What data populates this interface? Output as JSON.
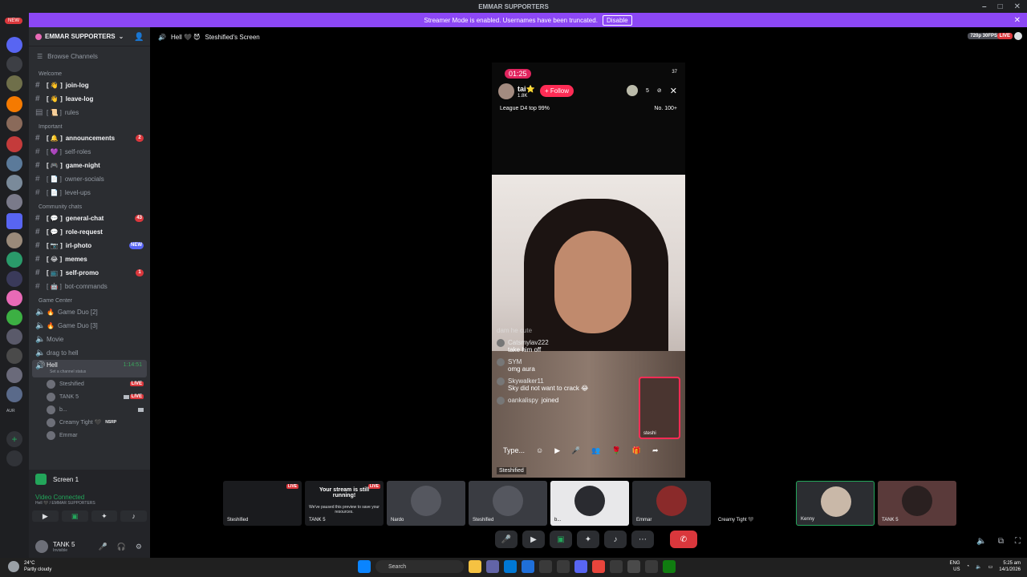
{
  "titlebar": {
    "title": "EMMAR SUPPORTERS",
    "min": "–",
    "max": "□",
    "close": "✕"
  },
  "banner": {
    "message": "Streamer Mode is enabled. Usernames have been truncated.",
    "button": "Disable",
    "close": "✕"
  },
  "rail": {
    "new_label": "NEW",
    "badges": [
      "94",
      "26",
      "25",
      "10",
      "28",
      "60",
      "77",
      "20",
      "8",
      "2",
      "57",
      "216",
      "288",
      "324",
      "138",
      "110",
      "389",
      "16+",
      "46"
    ],
    "aur": "AUR"
  },
  "server": {
    "name": "EMMAR SUPPORTERS",
    "browse": "Browse Channels",
    "categories": [
      {
        "name": "Welcome"
      },
      {
        "name": "Important"
      },
      {
        "name": "Community chats"
      },
      {
        "name": "Game Center"
      }
    ],
    "channels": [
      {
        "label": "join-log",
        "prefix": "[ 👋 ]",
        "unread": true
      },
      {
        "label": "leave-log",
        "prefix": "[ 👋 ]",
        "unread": true
      },
      {
        "label": "rules",
        "prefix": "[ 📜 ]",
        "unread": false
      },
      {
        "label": "announcements",
        "prefix": "[ 🔔 ]",
        "unread": true,
        "count": "2"
      },
      {
        "label": "self-roles",
        "prefix": "[ 💜 ]",
        "unread": false
      },
      {
        "label": "game-night",
        "prefix": "[ 🎮 ]",
        "unread": true
      },
      {
        "label": "owner-socials",
        "prefix": "[ 📄 ]",
        "unread": false
      },
      {
        "label": "level-ups",
        "prefix": "[ 📄 ]",
        "unread": false
      },
      {
        "label": "general-chat",
        "prefix": "[ 💬 ]",
        "unread": true,
        "count": "43"
      },
      {
        "label": "role-request",
        "prefix": "[ 💬 ]",
        "unread": true
      },
      {
        "label": "irl-photo",
        "prefix": "[ 📷 ]",
        "unread": true,
        "count": "NEW"
      },
      {
        "label": "memes",
        "prefix": "[ 😂 ]",
        "unread": true
      },
      {
        "label": "self-promo",
        "prefix": "[ 📺 ]",
        "unread": true,
        "count": "1"
      },
      {
        "label": "bot-commands",
        "prefix": "[ 🤖 ]",
        "unread": false
      },
      {
        "label": "Game Duo [2]",
        "prefix": "🔥",
        "unread": false
      },
      {
        "label": "Game Duo [3]",
        "prefix": "🔥",
        "unread": false
      },
      {
        "label": "Movie",
        "prefix": "",
        "unread": false
      },
      {
        "label": "drag to hell",
        "prefix": "",
        "unread": false
      }
    ],
    "active_voice": {
      "name": "Hell",
      "status": "Set a channel status",
      "timer": "1:14:51"
    },
    "voice_users": [
      {
        "name": "Steshified",
        "live": "LIVE"
      },
      {
        "name": "TANK 5",
        "live": "LIVE"
      },
      {
        "name": "b...",
        "live": ""
      },
      {
        "name": "Creamy Tight 🖤",
        "live": "",
        "tag": "NSRP"
      },
      {
        "name": "Emmar",
        "live": ""
      }
    ]
  },
  "panel": {
    "screen_label": "Screen 1",
    "voice_status": "Video Connected",
    "voice_sub": "Hell 🖤 / EMMAR SUPPORTERS",
    "user_name": "TANK 5",
    "user_status": "Invisible"
  },
  "header": {
    "channel": "Hell 🖤 😈",
    "stream": "Steshified's Screen",
    "resolution": "720p 30FPS",
    "live": "LIVE"
  },
  "stream": {
    "time": "01:25",
    "status": "37",
    "host_name": "tai⭐",
    "host_likes": "1.8K",
    "follow": "+ Follow",
    "viewer_count": "5",
    "league": "League D4 top 99%",
    "rank": "No. 100+",
    "comments": [
      {
        "user": "dam he cute",
        "text": ""
      },
      {
        "user": "Catsmylav222",
        "text": "take him off"
      },
      {
        "user": "SYM",
        "text": "omg aura"
      },
      {
        "user": "Skywalker11",
        "text": "Sky did not want to crack 😂"
      },
      {
        "user": "oankalispy",
        "text": "joined"
      }
    ],
    "pip_name": "steshi",
    "type_placeholder": "Type...",
    "tag": "Steshified"
  },
  "tiles": [
    {
      "label": "Steshified",
      "live": "LIVE",
      "msg": "",
      "msg2": ""
    },
    {
      "label": "TANK 5",
      "live": "LIVE",
      "msg": "Your stream is still running!",
      "msg2": "We've paused this preview to save your resources."
    },
    {
      "label": "Nardo",
      "live": "",
      "msg": "",
      "msg2": ""
    },
    {
      "label": "Steshified",
      "live": "",
      "msg": "",
      "msg2": ""
    },
    {
      "label": "b...",
      "live": "",
      "msg": "",
      "msg2": ""
    },
    {
      "label": "Emmar",
      "live": "",
      "msg": "",
      "msg2": ""
    },
    {
      "label": "Creamy Tight 🖤",
      "live": "",
      "msg": "",
      "msg2": ""
    },
    {
      "label": "Kenny",
      "live": "",
      "msg": "",
      "msg2": ""
    },
    {
      "label": "TANK 5",
      "live": "",
      "msg": "",
      "msg2": ""
    }
  ],
  "taskbar": {
    "temp": "24°C",
    "weather": "Partly cloudy",
    "search": "Search",
    "lang": "ENG",
    "region": "US",
    "time": "5:25 am",
    "date": "14/1/2026"
  }
}
